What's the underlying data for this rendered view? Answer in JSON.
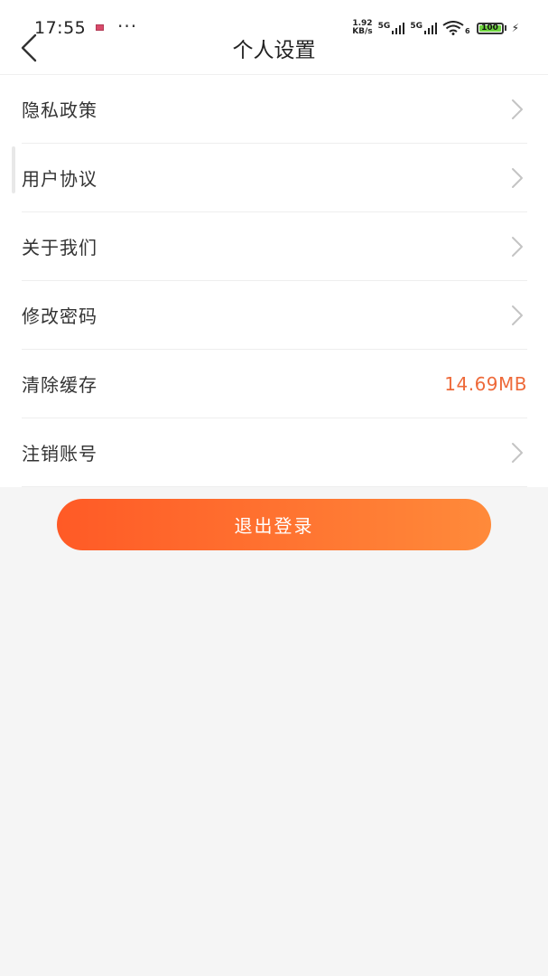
{
  "status_bar": {
    "time": "17:55",
    "dots": "···",
    "net_speed_value": "1.92",
    "net_speed_unit": "KB/s",
    "signal1_label": "5G",
    "signal2_label": "5G",
    "wifi_label": "6",
    "battery_level": "100",
    "battery_fraction": 1.0
  },
  "header": {
    "title": "个人设置"
  },
  "menu": {
    "items": [
      {
        "label": "隐私政策"
      },
      {
        "label": "用户协议"
      },
      {
        "label": "关于我们"
      },
      {
        "label": "修改密码"
      },
      {
        "label": "清除缓存",
        "value": "14.69MB"
      },
      {
        "label": "注销账号"
      }
    ]
  },
  "actions": {
    "logout_label": "退出登录"
  },
  "colors": {
    "accent": "#ff6a2c",
    "value_text": "#ee6a3a",
    "page_background": "#f5f5f5"
  },
  "icons": {
    "back": "chevron-left-icon",
    "row_arrow": "chevron-right-icon"
  }
}
